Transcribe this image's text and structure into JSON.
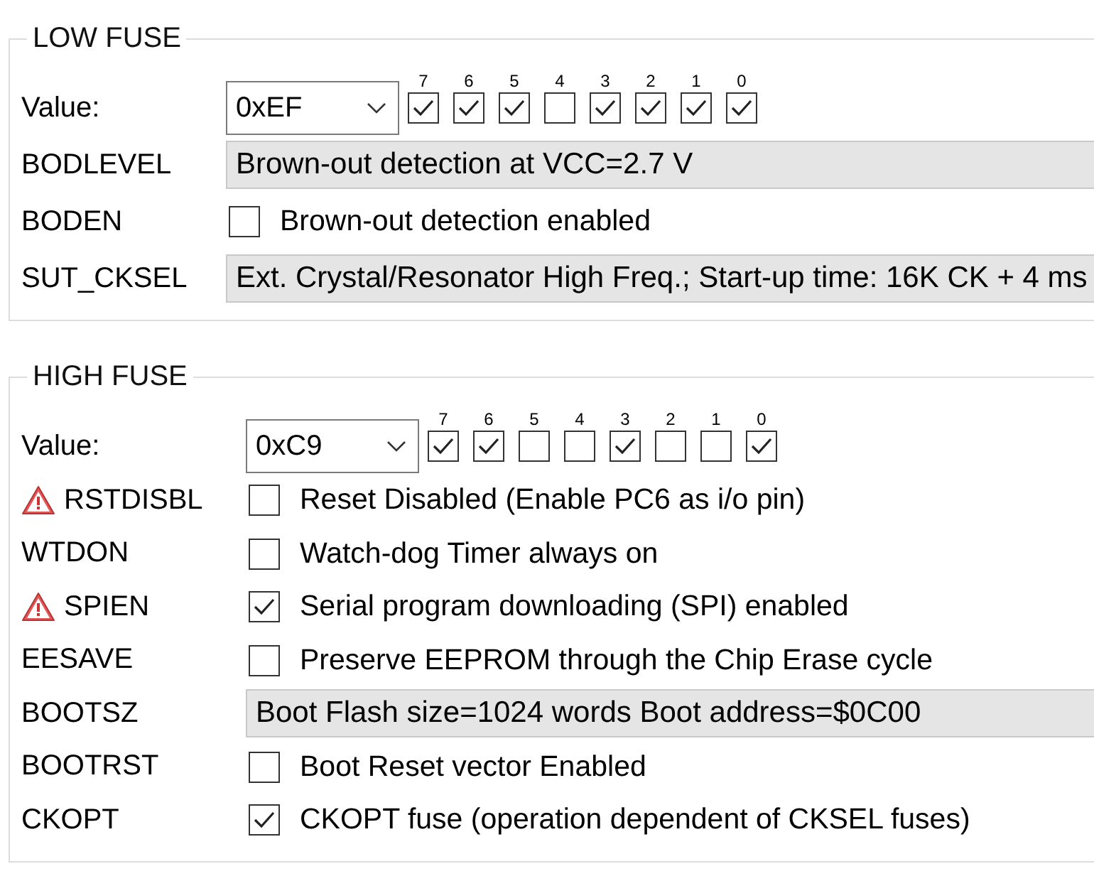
{
  "fuse_groups": [
    {
      "title": "LOW FUSE",
      "value_label": "Value:",
      "value": "0xEF",
      "bits": [
        {
          "label": "7",
          "checked": true
        },
        {
          "label": "6",
          "checked": true
        },
        {
          "label": "5",
          "checked": true
        },
        {
          "label": "4",
          "checked": false
        },
        {
          "label": "3",
          "checked": true
        },
        {
          "label": "2",
          "checked": true
        },
        {
          "label": "1",
          "checked": true
        },
        {
          "label": "0",
          "checked": true
        }
      ],
      "rows": [
        {
          "kind": "select",
          "name": "BODLEVEL",
          "warning": false,
          "text": "Brown-out detection at VCC=2.7 V"
        },
        {
          "kind": "check",
          "name": "BODEN",
          "warning": false,
          "text": "Brown-out detection enabled",
          "checked": false
        },
        {
          "kind": "select",
          "name": "SUT_CKSEL",
          "warning": false,
          "text": "Ext. Crystal/Resonator High Freq.; Start-up time: 16K CK + 4 ms"
        }
      ]
    },
    {
      "title": "HIGH FUSE",
      "value_label": "Value:",
      "value": "0xC9",
      "bits": [
        {
          "label": "7",
          "checked": true
        },
        {
          "label": "6",
          "checked": true
        },
        {
          "label": "5",
          "checked": false
        },
        {
          "label": "4",
          "checked": false
        },
        {
          "label": "3",
          "checked": true
        },
        {
          "label": "2",
          "checked": false
        },
        {
          "label": "1",
          "checked": false
        },
        {
          "label": "0",
          "checked": true
        }
      ],
      "rows": [
        {
          "kind": "check",
          "name": "RSTDISBL",
          "warning": true,
          "text": "Reset Disabled (Enable PC6 as i/o pin)",
          "checked": false
        },
        {
          "kind": "check",
          "name": "WTDON",
          "warning": false,
          "text": "Watch-dog Timer always on",
          "checked": false
        },
        {
          "kind": "check",
          "name": "SPIEN",
          "warning": true,
          "text": "Serial program downloading (SPI) enabled",
          "checked": true
        },
        {
          "kind": "check",
          "name": "EESAVE",
          "warning": false,
          "text": "Preserve EEPROM through the Chip Erase cycle",
          "checked": false
        },
        {
          "kind": "select",
          "name": "BOOTSZ",
          "warning": false,
          "text": "Boot Flash size=1024 words Boot address=$0C00"
        },
        {
          "kind": "check",
          "name": "BOOTRST",
          "warning": false,
          "text": "Boot Reset vector Enabled",
          "checked": false
        },
        {
          "kind": "check",
          "name": "CKOPT",
          "warning": false,
          "text": "CKOPT fuse (operation dependent of CKSEL fuses)",
          "checked": true
        }
      ]
    }
  ]
}
